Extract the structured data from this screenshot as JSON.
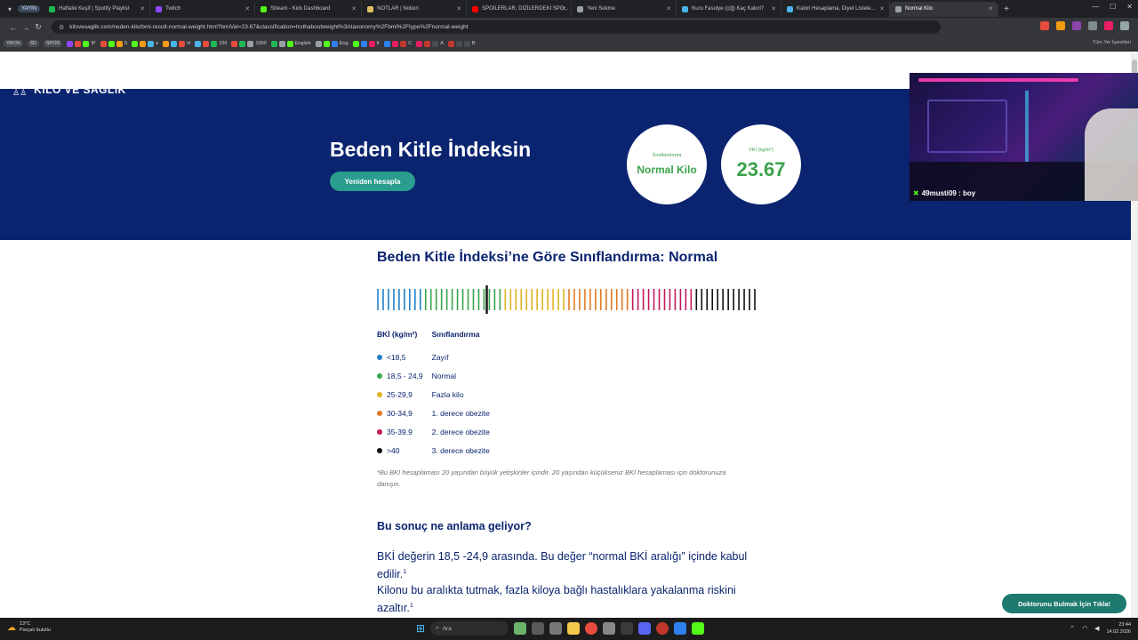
{
  "browser": {
    "profile_pill": "YAYIN",
    "tabs": [
      {
        "title": "Haftalık Keşif | Spotify Playlist",
        "color": "#1db954"
      },
      {
        "title": "Twitch",
        "color": "#9146ff"
      },
      {
        "title": "Stream - Kick Dashboard",
        "color": "#53fc18"
      },
      {
        "title": "NOTLAR | Notion",
        "color": "#e0c060"
      },
      {
        "title": "SPOİLERLAR, DİZİLERDEKİ SPO...",
        "color": "#ff0000"
      },
      {
        "title": "Yeni Sekme",
        "color": "#9aa0a6"
      },
      {
        "title": "Kuru Fasulye (çiğ) Kaç Kalori?",
        "color": "#4ab3e8"
      },
      {
        "title": "Kalori Hesaplama, Diyet Listele...",
        "color": "#4ab3e8"
      },
      {
        "title": "Normal Kilo",
        "color": "#9aa0a6"
      }
    ],
    "url": "kilovesaglik.com/neden-kilo/bmi-result-normal-weight.html?bmiVal=23.67&classification=truthaboutweight%3Ataxonomy%2Fbmi%2Ftype%2Fnormal-weight",
    "bookmarks": [
      "YAYIN",
      "3D",
      "SPOR",
      "IP",
      "S",
      "e",
      "H",
      "100",
      "1000",
      "English",
      "Eng",
      "K",
      "C",
      "A",
      "B"
    ],
    "bookmarks_right": "Tüm Yer İşaretleri"
  },
  "site": {
    "logo_text": "KİLO VE SAĞLIK",
    "hero_title": "Beden Kitle İndeksin",
    "recalc_label": "Yeniden hesapla",
    "classification_label": "Sınıflandırma",
    "classification_value": "Normal Kilo",
    "bmi_label": "VKİ (kg/m²)",
    "bmi_value": "23.67",
    "section_title": "Beden Kitle İndeksi’ne Göre Sınıflandırma: Normal",
    "scale": {
      "min": 15,
      "max": 45,
      "value": 23.67
    },
    "legend_headers": [
      "BKİ (kg/m²)",
      "Sınıflandırma"
    ],
    "legend_rows": [
      {
        "range": "<18,5",
        "label": "Zayıf",
        "color": "#1f7fc8"
      },
      {
        "range": "18,5 - 24,9",
        "label": "Normal",
        "color": "#3aa34a"
      },
      {
        "range": "25-29,9",
        "label": "Fazla kilo",
        "color": "#e0b323"
      },
      {
        "range": "30-34,9",
        "label": "1. derece obezite",
        "color": "#e07a22"
      },
      {
        "range": "35-39.9",
        "label": "2. derece obezite",
        "color": "#c2185b"
      },
      {
        "range": ">40",
        "label": "3. derece obezite",
        "color": "#111111"
      }
    ],
    "footnote": "*Bu BKİ hesaplaması 20 yaşından büyük yetişkinler içindir. 20 yaşından küçükseniz BKİ hesaplaması için doktorunuza danışın.",
    "meaning_title": "Bu sonuç ne anlama geliyor?",
    "para1": "BKİ değerin 18,5 -24,9 arasında. Bu değer “normal BKİ aralığı” içinde kabul edilir.",
    "para2": "Kilonu bu aralıkta tutmak, fazla kiloya bağlı hastalıklara yakalanma riskini azaltır.",
    "sup": "1",
    "doctor_button": "Doktorunu Bulmak İçin Tıkla!"
  },
  "overlay": {
    "chat_user": "49musti09",
    "chat_message": "boy"
  },
  "taskbar": {
    "temperature": "13°C",
    "weather": "Parçalı bulutlu",
    "search": "Ara",
    "time": "23:44",
    "date": "14.02.2026"
  }
}
